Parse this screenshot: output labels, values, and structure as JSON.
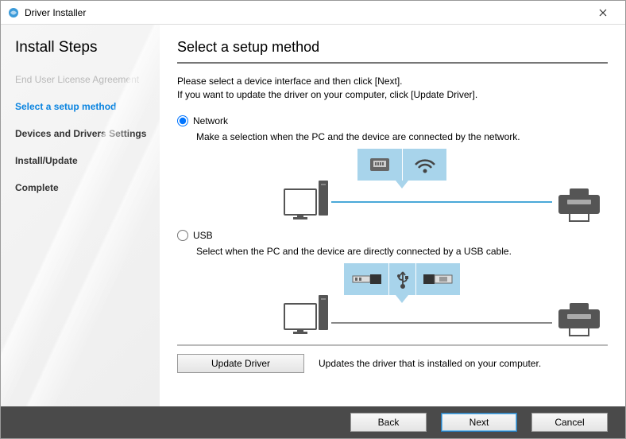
{
  "window": {
    "title": "Driver Installer"
  },
  "sidebar": {
    "heading": "Install Steps",
    "steps": [
      {
        "label": "End User License Agreement",
        "state": "disabled"
      },
      {
        "label": "Select a setup method",
        "state": "active"
      },
      {
        "label": "Devices and Drivers Settings",
        "state": "normal"
      },
      {
        "label": "Install/Update",
        "state": "normal"
      },
      {
        "label": "Complete",
        "state": "normal"
      }
    ]
  },
  "main": {
    "heading": "Select a setup method",
    "intro_line1": "Please select a device interface and then click [Next].",
    "intro_line2": "If you want to update the driver on your computer, click [Update Driver].",
    "options": {
      "network": {
        "label": "Network",
        "desc": "Make a selection when the PC and the device are connected by the network.",
        "selected": true
      },
      "usb": {
        "label": "USB",
        "desc": "Select when the PC and the device are directly connected by a USB cable.",
        "selected": false
      }
    },
    "update_button": "Update Driver",
    "update_desc": "Updates the driver that is installed on your computer."
  },
  "footer": {
    "back": "Back",
    "next": "Next",
    "cancel": "Cancel"
  }
}
